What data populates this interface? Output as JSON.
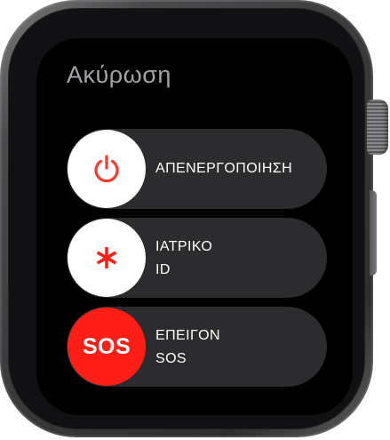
{
  "screen": {
    "cancel_label": "Ακύρωση"
  },
  "sliders": [
    {
      "icon": "power-icon",
      "label_line1": "ΑΠΕΝΕΡΓΟΠΟΙΗΣΗ",
      "label_line2": "",
      "knob_color": "#ffffff",
      "icon_color": "#ff3b30"
    },
    {
      "icon": "medical-asterisk-icon",
      "label_line1": "ΙΑΤΡΙΚΟ",
      "label_line2": "ID",
      "knob_color": "#ffffff",
      "icon_color": "#ff1f17"
    },
    {
      "icon": "sos-icon",
      "icon_text": "SOS",
      "label_line1": "ΕΠΕΙΓΟΝ",
      "label_line2": "SOS",
      "knob_color": "#ff1f17",
      "icon_color": "#ffffff"
    }
  ],
  "colors": {
    "background": "#000000",
    "slider_track": "#2c2c2e",
    "cancel_text": "#a3a3a8",
    "accent_red": "#ff1f17"
  }
}
